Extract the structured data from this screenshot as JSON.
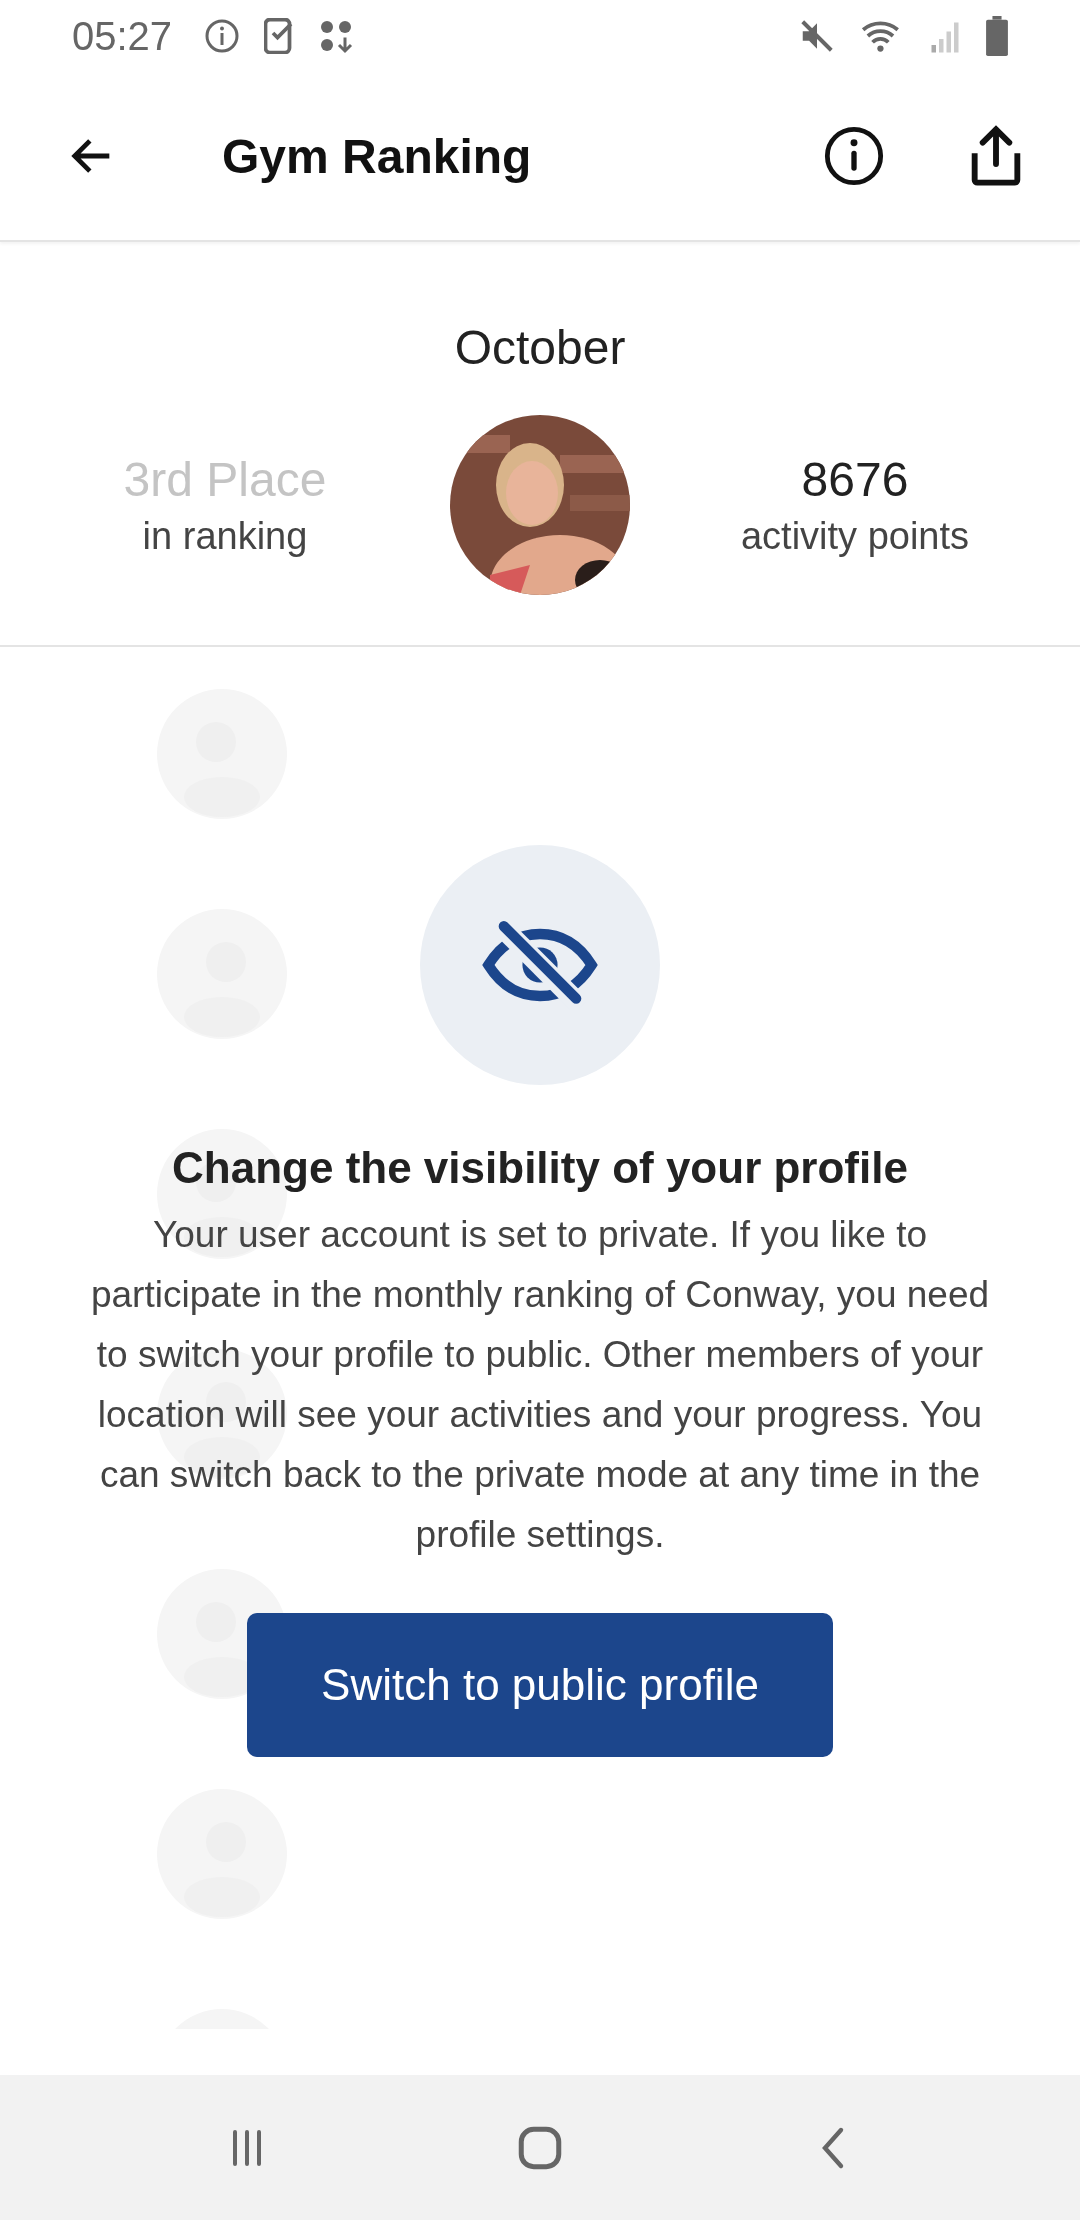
{
  "status_bar": {
    "time": "05:27"
  },
  "app_bar": {
    "title": "Gym Ranking"
  },
  "month": "October",
  "summary": {
    "place": "3rd Place",
    "place_label": "in ranking",
    "points": "8676",
    "points_label": "activity points"
  },
  "privacy_dialog": {
    "title": "Change the visibility of your profile",
    "message": "Your user account is set to private. If you like to participate in the monthly ranking of Conway, you need to switch your profile to public. Other members of your location will see your activities and your progress. You can switch back to the private mode at any time in the profile settings.",
    "button": "Switch to public profile"
  }
}
